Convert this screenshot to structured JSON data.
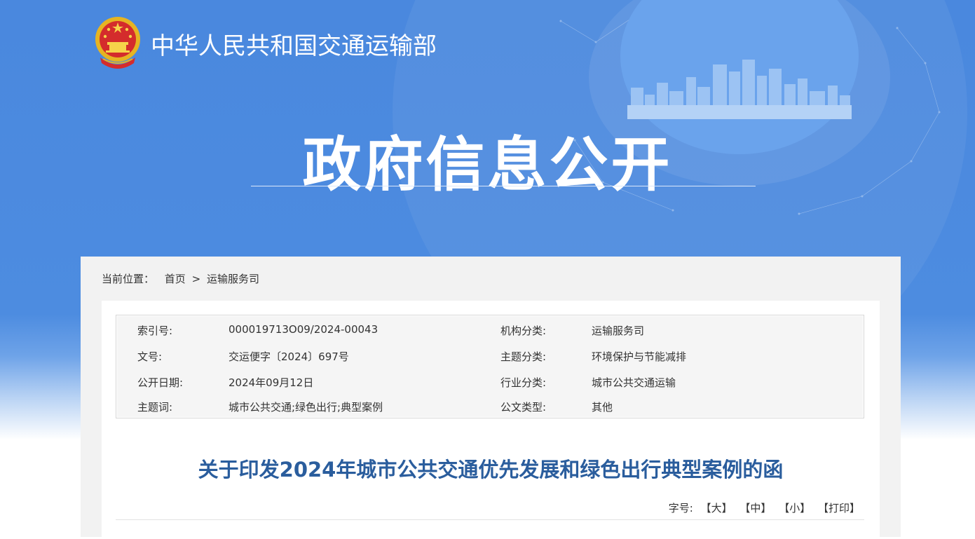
{
  "header": {
    "ministry_name": "中华人民共和国交通运输部",
    "section_title": "政府信息公开",
    "colors": {
      "banner": "#4a88de",
      "accent_text": "#2a5d9d"
    }
  },
  "breadcrumb": {
    "prefix": "当前位置：",
    "home": "首页",
    "separator": ">",
    "current": "运输服务司"
  },
  "meta": {
    "rows": [
      {
        "label1": "索引号:",
        "value1": "000019713O09/2024-00043",
        "label2": "机构分类:",
        "value2": "运输服务司"
      },
      {
        "label1": "文号:",
        "value1": "交运便字〔2024〕697号",
        "label2": "主题分类:",
        "value2": "环境保护与节能减排"
      },
      {
        "label1": "公开日期:",
        "value1": "2024年09月12日",
        "label2": "行业分类:",
        "value2": "城市公共交通运输"
      },
      {
        "label1": "主题词:",
        "value1": "城市公共交通;绿色出行;典型案例",
        "label2": "公文类型:",
        "value2": "其他"
      }
    ]
  },
  "document": {
    "title": "关于印发2024年城市公共交通优先发展和绿色出行典型案例的函"
  },
  "font_tools": {
    "label": "字号:",
    "large": "【大】",
    "medium": "【中】",
    "small": "【小】",
    "print": "【打印】"
  }
}
